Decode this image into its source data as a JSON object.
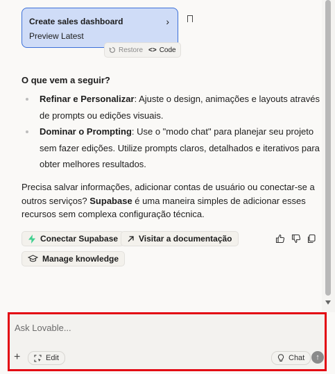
{
  "card": {
    "title": "Create sales dashboard",
    "subtitle": "Preview Latest",
    "restore_label": "Restore",
    "code_label": "Code"
  },
  "heading": "O que vem a seguir?",
  "list": [
    {
      "bold": "Refinar e Personalizar",
      "text": ": Ajuste o design, animações e layouts através de prompts ou edições visuais."
    },
    {
      "bold": "Dominar o Prompting",
      "text": ": Use o \"modo chat\" para planejar seu projeto sem fazer edições. Utilize prompts claros, detalhados e iterativos para obter melhores resultados."
    }
  ],
  "paragraph": {
    "before": "Precisa salvar informações, adicionar contas de usuário ou conectar-se a outros serviços? ",
    "bold": "Supabase",
    "after": " é uma maneira simples de adicionar esses recursos sem complexa configuração técnica."
  },
  "actions": {
    "connect_supabase": "Conectar Supabase",
    "visit_docs": "Visitar a documentação",
    "manage_knowledge": "Manage knowledge"
  },
  "composer": {
    "placeholder": "Ask Lovable...",
    "edit_label": "Edit",
    "chat_label": "Chat"
  },
  "colors": {
    "card_bg": "#cfdcf7",
    "card_border": "#3b6fd8",
    "highlight_border": "#e30613",
    "supabase_green": "#3ecf8e"
  }
}
